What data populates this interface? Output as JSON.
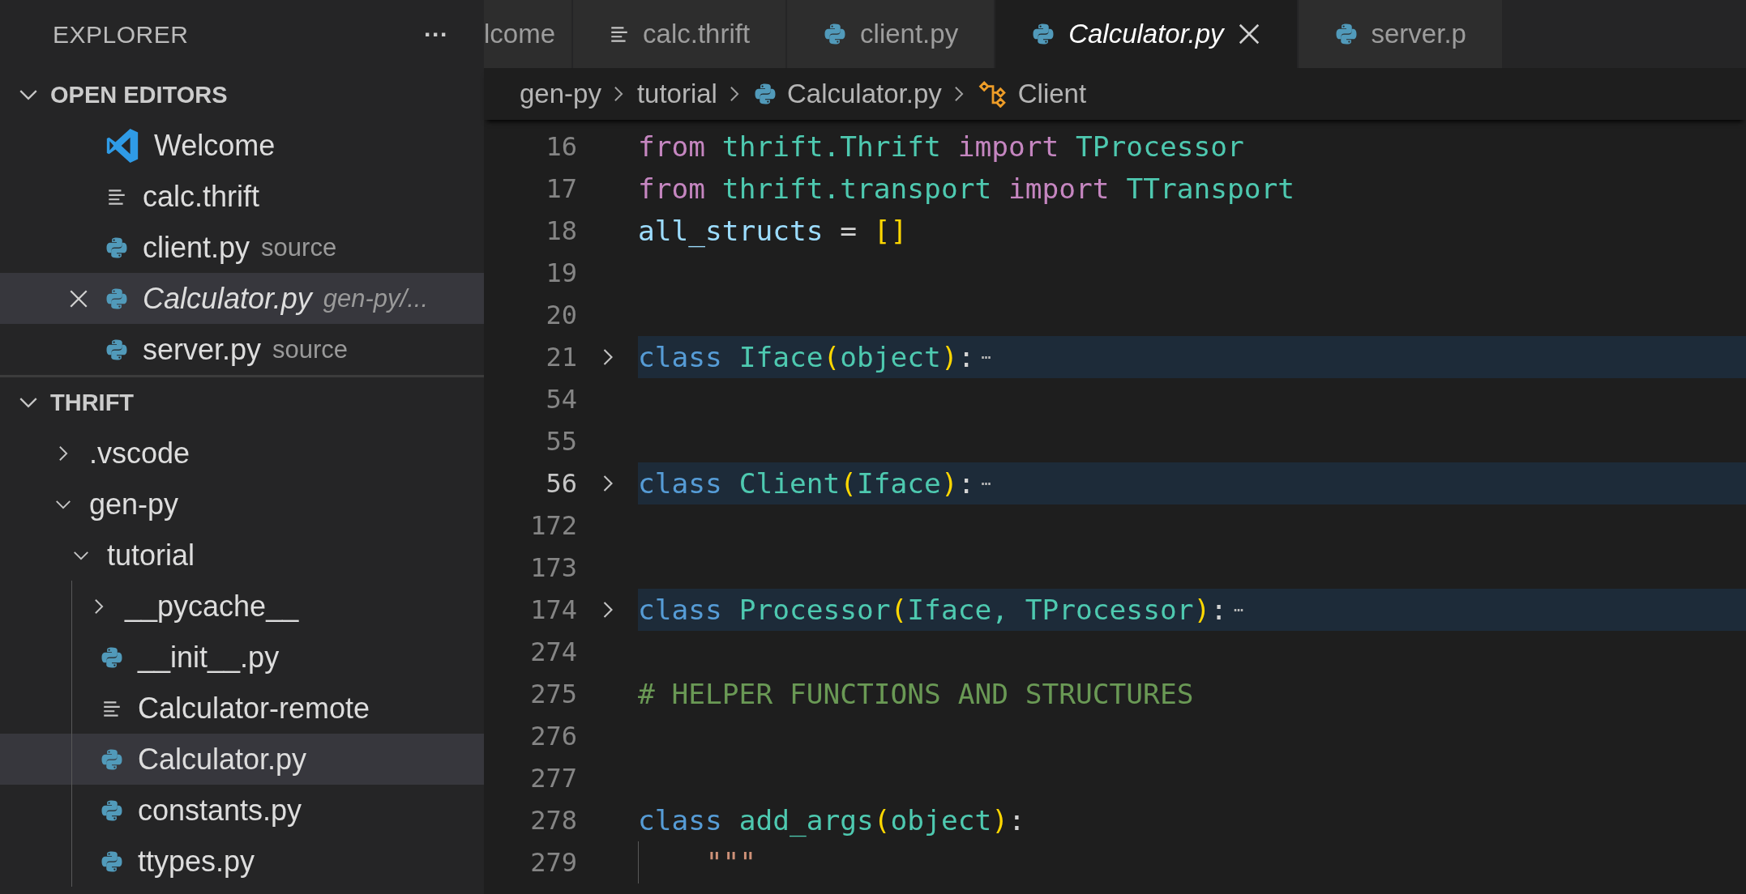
{
  "sidebar": {
    "title": "EXPLORER",
    "more": "···",
    "open_editors": {
      "label": "OPEN EDITORS",
      "expanded": true,
      "items": [
        {
          "name": "Welcome",
          "kind": "vscode",
          "selected": false,
          "preview": false
        },
        {
          "name": "calc.thrift",
          "kind": "lines",
          "selected": false,
          "preview": false
        },
        {
          "name": "client.py",
          "description": "source",
          "kind": "python",
          "selected": false,
          "preview": false
        },
        {
          "name": "Calculator.py",
          "description": "gen-py/...",
          "kind": "python",
          "selected": true,
          "preview": true
        },
        {
          "name": "server.py",
          "description": "source",
          "kind": "python",
          "selected": false,
          "preview": false
        }
      ]
    },
    "folder": {
      "label": "THRIFT",
      "expanded": true,
      "items": [
        {
          "name": ".vscode",
          "kind": "folder",
          "expanded": false,
          "selected": false
        },
        {
          "name": "gen-py",
          "kind": "folder",
          "expanded": true,
          "selected": false,
          "children": [
            {
              "name": "tutorial",
              "kind": "folder",
              "expanded": true,
              "selected": false,
              "children": [
                {
                  "name": "__pycache__",
                  "kind": "folder",
                  "expanded": false,
                  "selected": false
                },
                {
                  "name": "__init__.py",
                  "kind": "python",
                  "selected": false
                },
                {
                  "name": "Calculator-remote",
                  "kind": "lines",
                  "selected": false
                },
                {
                  "name": "Calculator.py",
                  "kind": "python",
                  "selected": true
                },
                {
                  "name": "constants.py",
                  "kind": "python",
                  "selected": false
                },
                {
                  "name": "ttypes.py",
                  "kind": "python",
                  "selected": false
                }
              ]
            }
          ]
        }
      ]
    }
  },
  "tabs": [
    {
      "label": "lcome",
      "kind": "plain",
      "selected": false,
      "preview": false
    },
    {
      "label": "calc.thrift",
      "kind": "lines",
      "selected": false,
      "preview": false
    },
    {
      "label": "client.py",
      "kind": "python",
      "selected": false,
      "preview": false
    },
    {
      "label": "Calculator.py",
      "kind": "python",
      "selected": true,
      "preview": true
    },
    {
      "label": "server.p",
      "kind": "python",
      "selected": false,
      "preview": false
    }
  ],
  "breadcrumb": [
    {
      "text": "gen-py",
      "kind": "folder"
    },
    {
      "text": "tutorial",
      "kind": "folder"
    },
    {
      "text": "Calculator.py",
      "kind": "python"
    },
    {
      "text": "Client",
      "kind": "class"
    }
  ],
  "code": [
    {
      "number": "16",
      "folded": false,
      "current": false,
      "tokens": [
        {
          "text": "from ",
          "kind": "keyword"
        },
        {
          "text": "thrift.Thrift ",
          "kind": "type"
        },
        {
          "text": "import ",
          "kind": "keyword"
        },
        {
          "text": "TProcessor",
          "kind": "type"
        }
      ]
    },
    {
      "number": "17",
      "folded": false,
      "current": false,
      "tokens": [
        {
          "text": "from ",
          "kind": "keyword"
        },
        {
          "text": "thrift.transport ",
          "kind": "type"
        },
        {
          "text": "import ",
          "kind": "keyword"
        },
        {
          "text": "TTransport",
          "kind": "type"
        }
      ]
    },
    {
      "number": "18",
      "folded": false,
      "current": false,
      "tokens": [
        {
          "text": "all_structs",
          "kind": "variable"
        },
        {
          "text": " = ",
          "kind": "plain"
        },
        {
          "text": "[]",
          "kind": "bracket"
        }
      ]
    },
    {
      "number": "19",
      "folded": false,
      "current": false
    },
    {
      "number": "20",
      "folded": false,
      "current": false
    },
    {
      "number": "21",
      "folded": true,
      "current": false,
      "tokens": [
        {
          "text": "class ",
          "kind": "storage"
        },
        {
          "text": "Iface",
          "kind": "type"
        },
        {
          "text": "(",
          "kind": "bracket"
        },
        {
          "text": "object",
          "kind": "type"
        },
        {
          "text": ")",
          "kind": "bracket"
        },
        {
          "text": ":",
          "kind": "plain"
        },
        {
          "text": "⋯",
          "kind": "fold"
        }
      ]
    },
    {
      "number": "54",
      "folded": false,
      "current": false
    },
    {
      "number": "55",
      "folded": false,
      "current": false
    },
    {
      "number": "56",
      "folded": true,
      "current": true,
      "tokens": [
        {
          "text": "class ",
          "kind": "storage"
        },
        {
          "text": "Client",
          "kind": "type"
        },
        {
          "text": "(",
          "kind": "bracket"
        },
        {
          "text": "Iface",
          "kind": "type"
        },
        {
          "text": ")",
          "kind": "bracket"
        },
        {
          "text": ":",
          "kind": "plain"
        },
        {
          "text": "⋯",
          "kind": "fold"
        }
      ]
    },
    {
      "number": "172",
      "folded": false,
      "current": false
    },
    {
      "number": "173",
      "folded": false,
      "current": false
    },
    {
      "number": "174",
      "folded": true,
      "current": false,
      "tokens": [
        {
          "text": "class ",
          "kind": "storage"
        },
        {
          "text": "Processor",
          "kind": "type"
        },
        {
          "text": "(",
          "kind": "bracket"
        },
        {
          "text": "Iface, ",
          "kind": "type"
        },
        {
          "text": "TProcessor",
          "kind": "type"
        },
        {
          "text": ")",
          "kind": "bracket"
        },
        {
          "text": ":",
          "kind": "plain"
        },
        {
          "text": "⋯",
          "kind": "fold"
        }
      ]
    },
    {
      "number": "274",
      "folded": false,
      "current": false
    },
    {
      "number": "275",
      "folded": false,
      "current": false,
      "tokens": [
        {
          "text": "# HELPER FUNCTIONS AND STRUCTURES",
          "kind": "comment"
        }
      ]
    },
    {
      "number": "276",
      "folded": false,
      "current": false
    },
    {
      "number": "277",
      "folded": false,
      "current": false
    },
    {
      "number": "278",
      "folded": false,
      "current": false,
      "tokens": [
        {
          "text": "class ",
          "kind": "storage"
        },
        {
          "text": "add_args",
          "kind": "type"
        },
        {
          "text": "(",
          "kind": "bracket"
        },
        {
          "text": "object",
          "kind": "type"
        },
        {
          "text": ")",
          "kind": "bracket"
        },
        {
          "text": ":",
          "kind": "plain"
        }
      ]
    },
    {
      "number": "279",
      "folded": false,
      "current": false,
      "indented": true,
      "tokens": [
        {
          "text": "\"\"\"",
          "kind": "string"
        }
      ]
    }
  ]
}
